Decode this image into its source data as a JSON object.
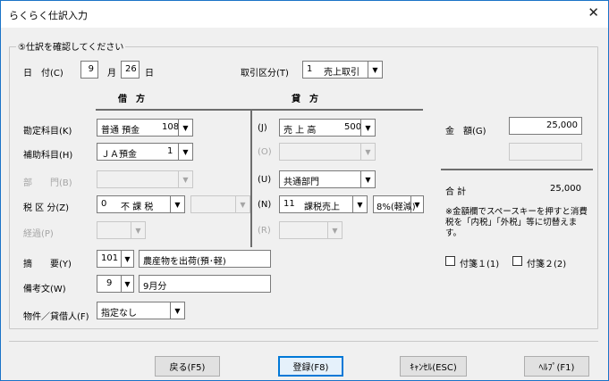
{
  "window": {
    "title": "らくらく仕訳入力",
    "close_glyph": "✕"
  },
  "group": {
    "legend": "⑤仕訳を確認してください"
  },
  "date": {
    "label": "日　付(C)",
    "month": "9",
    "month_unit": "月",
    "day": "26",
    "day_unit": "日"
  },
  "torihiki": {
    "label": "取引区分(T)",
    "value_code": "1",
    "value_name": "売上取引"
  },
  "headers": {
    "debit": "借　方",
    "credit": "貸　方"
  },
  "debit": {
    "account": {
      "label": "勘定科目(K)",
      "name": "普通 預金",
      "code": "108"
    },
    "sub": {
      "label": "補助科目(H)",
      "name": "ＪＡ預金",
      "code": "1"
    },
    "dept": {
      "label": "部　　門(B)"
    },
    "tax": {
      "label": "税 区 分(Z)",
      "code": "0",
      "name": "不 課 税"
    },
    "keika": {
      "label": "経過(P)"
    }
  },
  "credit": {
    "account": {
      "key": "(J)",
      "name": "売 上 高",
      "code": "500"
    },
    "sub": {
      "key": "(O)"
    },
    "dept": {
      "key": "(U)",
      "name": "共通部門"
    },
    "tax": {
      "key": "(N)",
      "code": "11",
      "name": "課税売上",
      "rate": "8%(軽減)"
    },
    "keika": {
      "key": "(R)"
    }
  },
  "amount": {
    "label": "金　額(G)",
    "value": "25,000"
  },
  "total": {
    "label": "合 計",
    "value": "25,000"
  },
  "note": "※金額欄でスペースキーを押すと消費税を「内税」「外税」等に切替えます。",
  "tekiyo": {
    "label": "摘　　要(Y)",
    "code": "101",
    "text": "農産物を出荷(預･軽)"
  },
  "biko": {
    "label": "備考文(W)",
    "code": "9",
    "text": "9月分"
  },
  "bukken": {
    "label": "物件／貸借人(F)",
    "value": "指定なし"
  },
  "fusen1": {
    "label": "付箋１(1)",
    "checked": false
  },
  "fusen2": {
    "label": "付箋２(2)",
    "checked": false
  },
  "buttons": {
    "back": "戻る(F5)",
    "register": "登録(F8)",
    "cancel": "ｷｬﾝｾﾙ(ESC)",
    "help": "ﾍﾙﾌﾟ(F1)"
  }
}
